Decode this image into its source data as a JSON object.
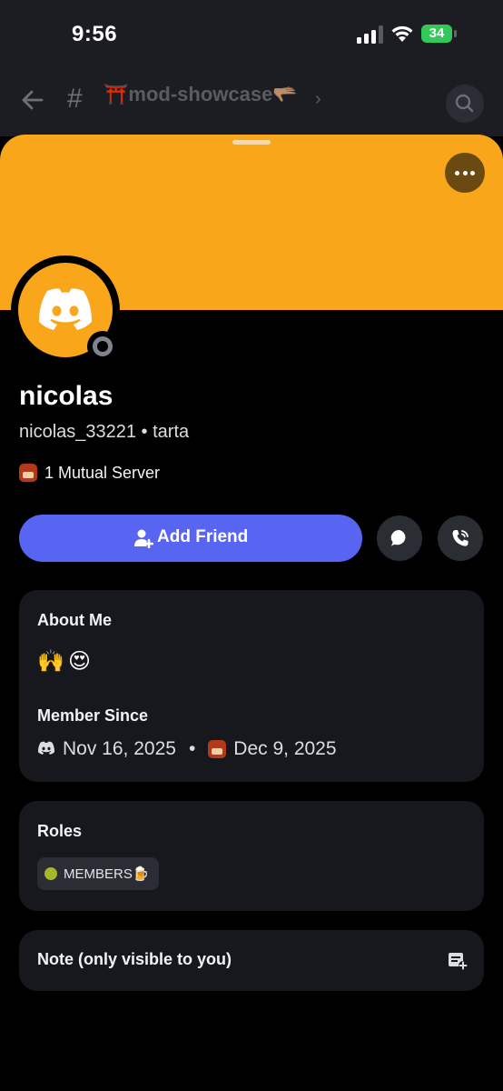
{
  "status_bar": {
    "time": "9:56",
    "battery": "34"
  },
  "nav": {
    "channel_hash": "#",
    "channel_name": "⛩️mod-showcase🫳🏽",
    "chevron": "›"
  },
  "profile": {
    "display_name": "nicolas",
    "username": "nicolas_33221",
    "separator": " • ",
    "pronouns": "tarta",
    "mutual_servers": "1 Mutual Server",
    "banner_color": "#faa61a",
    "status": "offline"
  },
  "actions": {
    "add_friend_label": "Add Friend",
    "message_icon": "chat-bubble-icon",
    "call_icon": "phone-call-icon",
    "accent": "#5865f2"
  },
  "about": {
    "heading": "About Me",
    "emojis": [
      "🙌",
      "😍"
    ]
  },
  "member_since": {
    "heading": "Member Since",
    "discord_date": "Nov 16, 2025",
    "dot": "•",
    "server_date": "Dec 9, 2025"
  },
  "roles": {
    "heading": "Roles",
    "items": [
      {
        "name": "MEMBERS🍺",
        "color": "#a8b62a"
      }
    ]
  },
  "note": {
    "heading": "Note (only visible to you)"
  }
}
